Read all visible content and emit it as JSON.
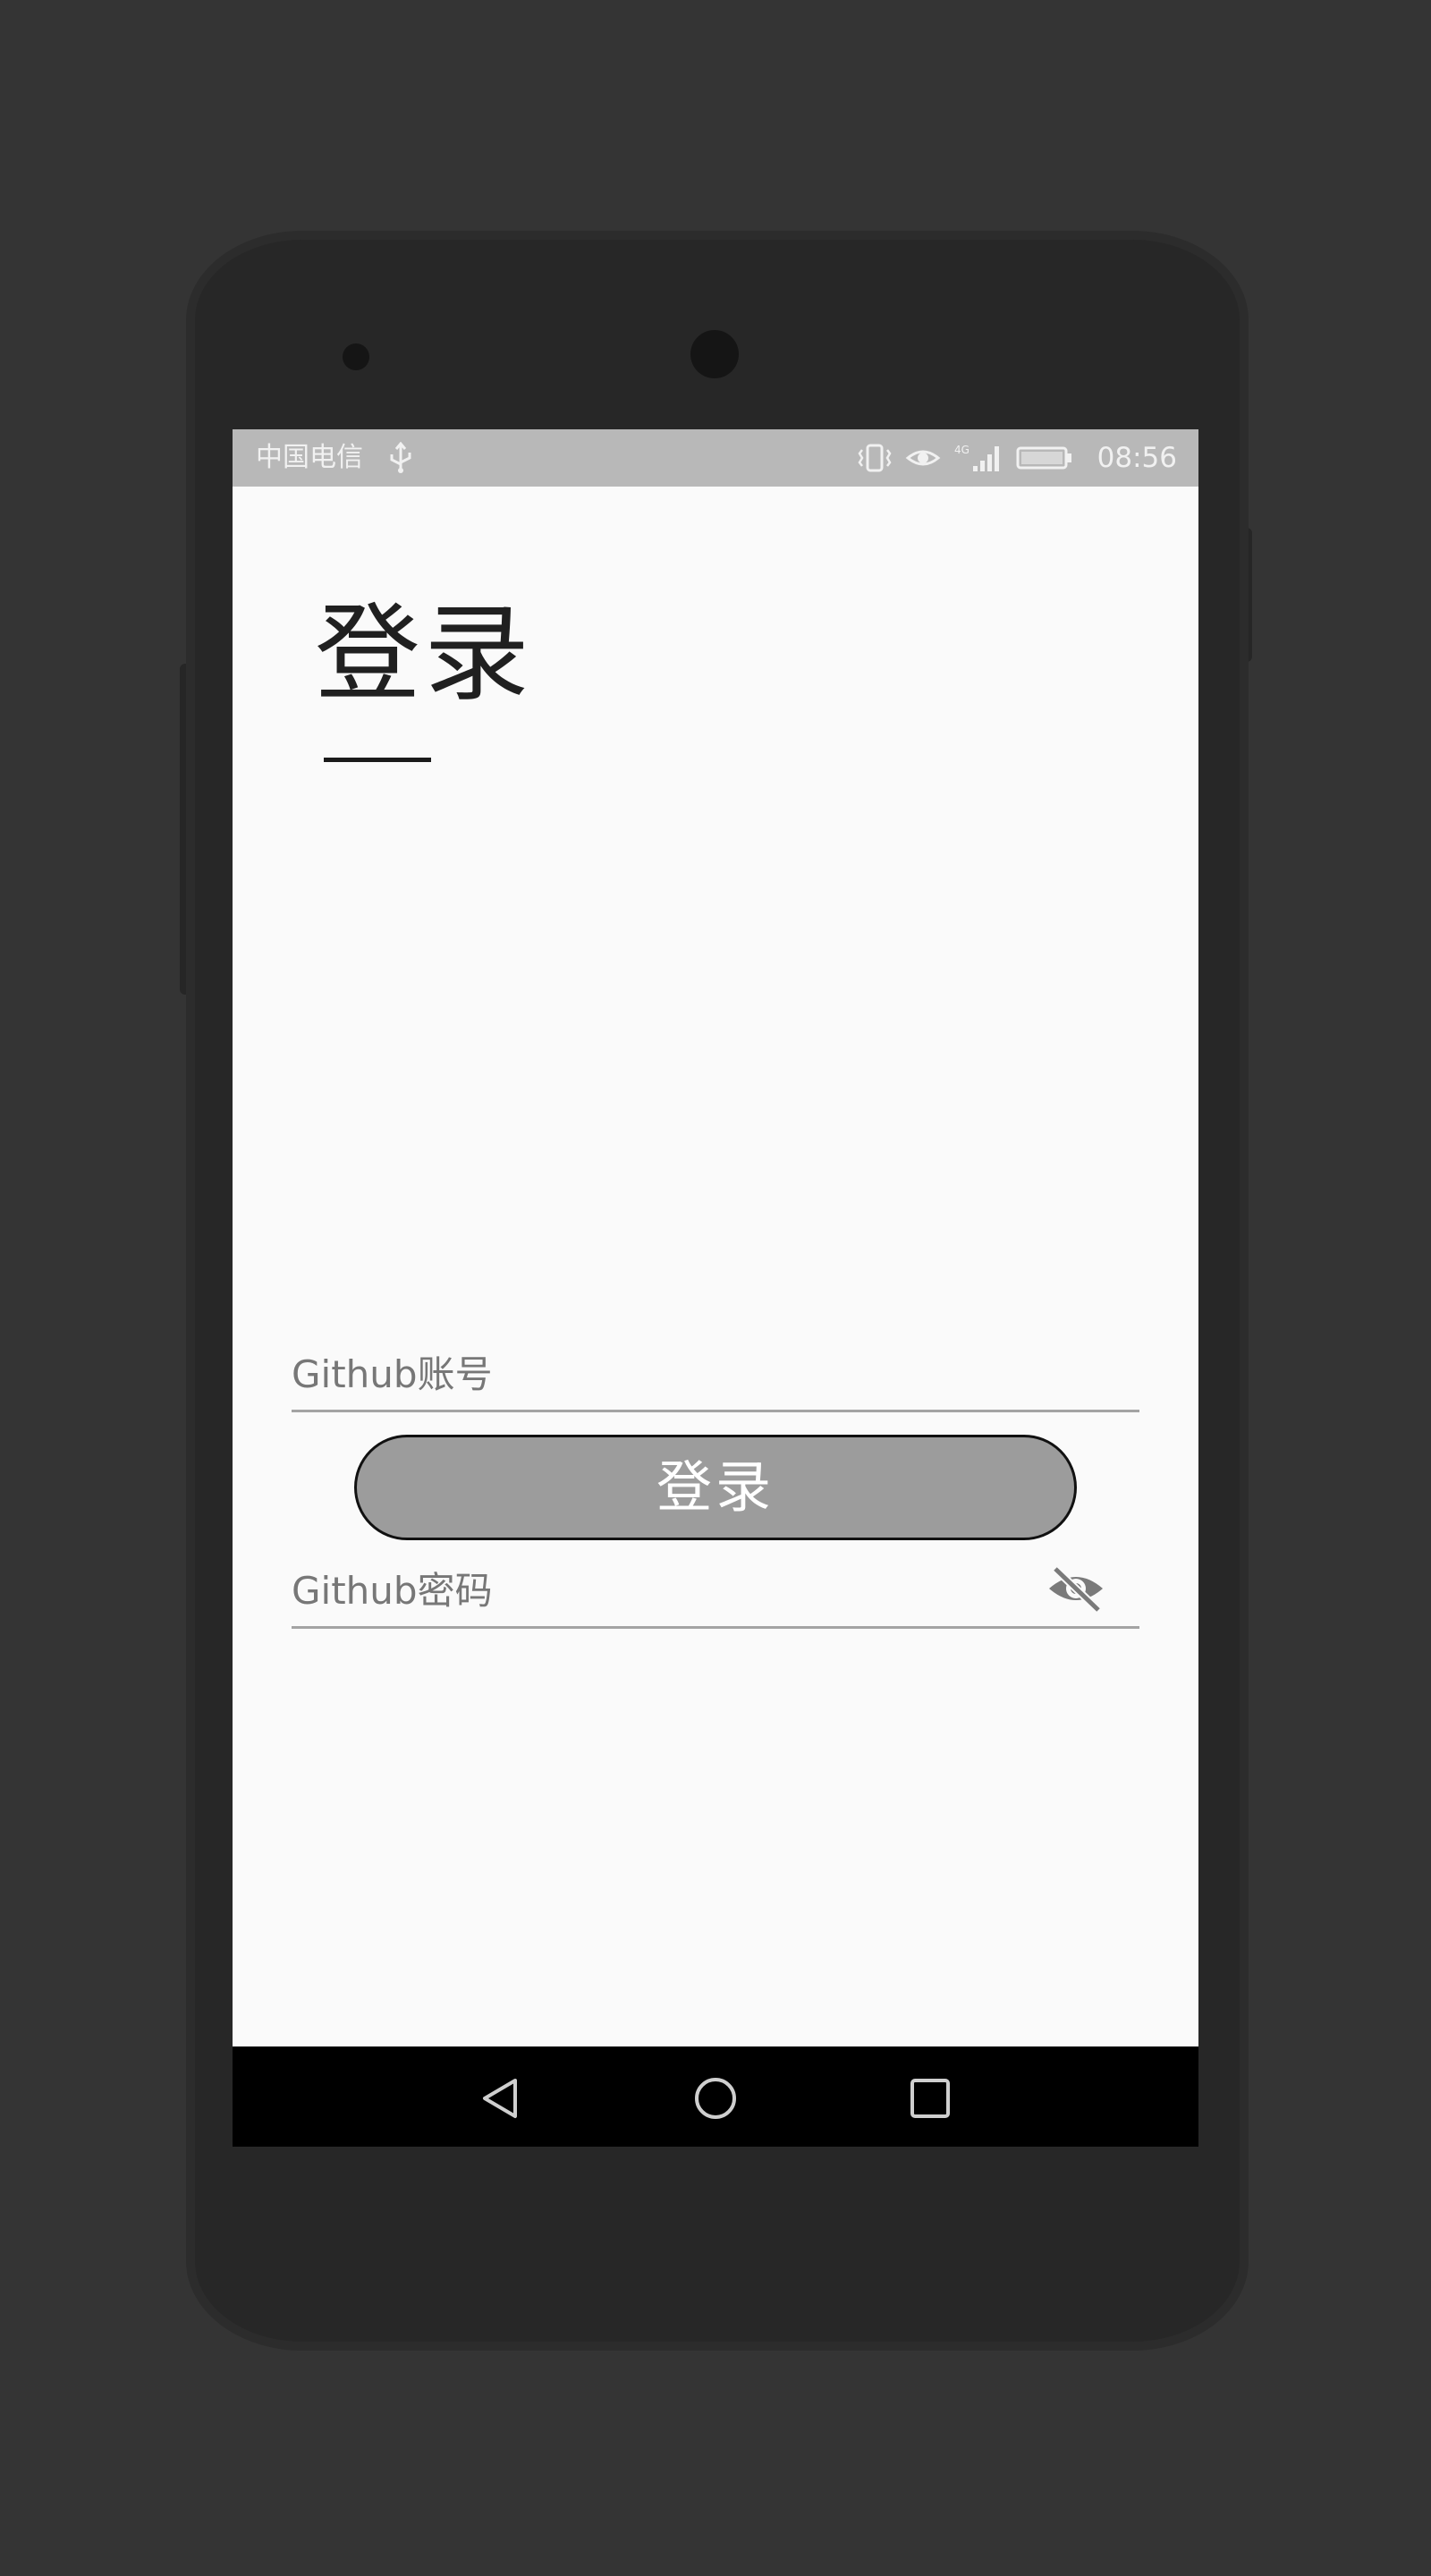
{
  "status_bar": {
    "carrier": "中国电信",
    "time": "08:56",
    "icons": [
      "usb-icon",
      "vibrate-icon",
      "eye-comfort-icon",
      "signal-4g-icon",
      "battery-icon"
    ]
  },
  "page": {
    "title": "登录"
  },
  "form": {
    "account_placeholder": "Github账号",
    "password_placeholder": "Github密码",
    "password_toggle_icon": "eye-off-icon",
    "login_button_label": "登录"
  },
  "nav_bar": {
    "buttons": [
      "back-icon",
      "home-icon",
      "recent-apps-icon"
    ]
  },
  "colors": {
    "screen_bg": "#fafafa",
    "status_bar_bg": "#b8b8b8",
    "button_bg": "#9c9c9c",
    "nav_bar_bg": "#000000"
  }
}
